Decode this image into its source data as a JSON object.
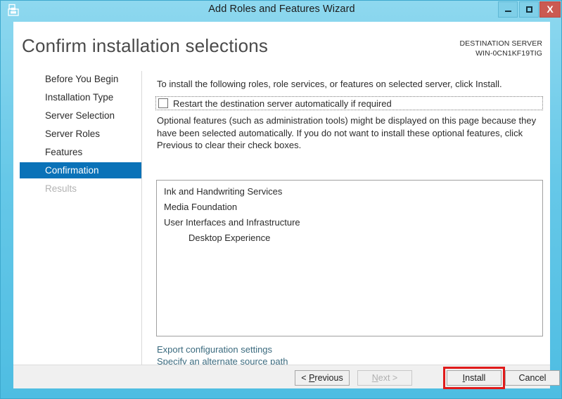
{
  "window": {
    "title": "Add Roles and Features Wizard",
    "icon": "server-wizard-icon",
    "minimize_label": "–",
    "maximize_label": "□",
    "close_label": "X",
    "frame_color": "#66c8e8"
  },
  "header": {
    "page_title": "Confirm installation selections",
    "destination_label": "DESTINATION SERVER",
    "destination_value": "WIN-0CN1KF19TIG"
  },
  "sidebar": {
    "items": [
      {
        "label": "Before You Begin",
        "state": "normal"
      },
      {
        "label": "Installation Type",
        "state": "normal"
      },
      {
        "label": "Server Selection",
        "state": "normal"
      },
      {
        "label": "Server Roles",
        "state": "normal"
      },
      {
        "label": "Features",
        "state": "normal"
      },
      {
        "label": "Confirmation",
        "state": "selected"
      },
      {
        "label": "Results",
        "state": "disabled"
      }
    ],
    "selected_color": "#0a72b8"
  },
  "main": {
    "intro_text": "To install the following roles, role services, or features on selected server, click Install.",
    "restart_checkbox": {
      "label": "Restart the destination server automatically if required",
      "checked": false,
      "focused": true
    },
    "optional_text": "Optional features (such as administration tools) might be displayed on this page because they have been selected automatically. If you do not want to install these optional features, click Previous to clear their check boxes.",
    "features": [
      {
        "label": "Ink and Handwriting Services",
        "level": 0
      },
      {
        "label": "Media Foundation",
        "level": 0
      },
      {
        "label": "User Interfaces and Infrastructure",
        "level": 0
      },
      {
        "label": "Desktop Experience",
        "level": 1
      }
    ],
    "links": [
      {
        "label": "Export configuration settings"
      },
      {
        "label": "Specify an alternate source path"
      }
    ],
    "link_color": "#3a6a7e"
  },
  "footer": {
    "previous": {
      "prefix": "< ",
      "accesskey": "P",
      "suffix": "revious",
      "enabled": true
    },
    "next": {
      "prefix": "",
      "accesskey": "N",
      "suffix": "ext >",
      "enabled": false
    },
    "install": {
      "prefix": "",
      "accesskey": "I",
      "suffix": "nstall",
      "enabled": true
    },
    "cancel": {
      "prefix": "",
      "accesskey": "",
      "suffix": "Cancel",
      "enabled": true
    }
  },
  "annotation": {
    "target": "install-button",
    "color": "#e01b1b"
  }
}
